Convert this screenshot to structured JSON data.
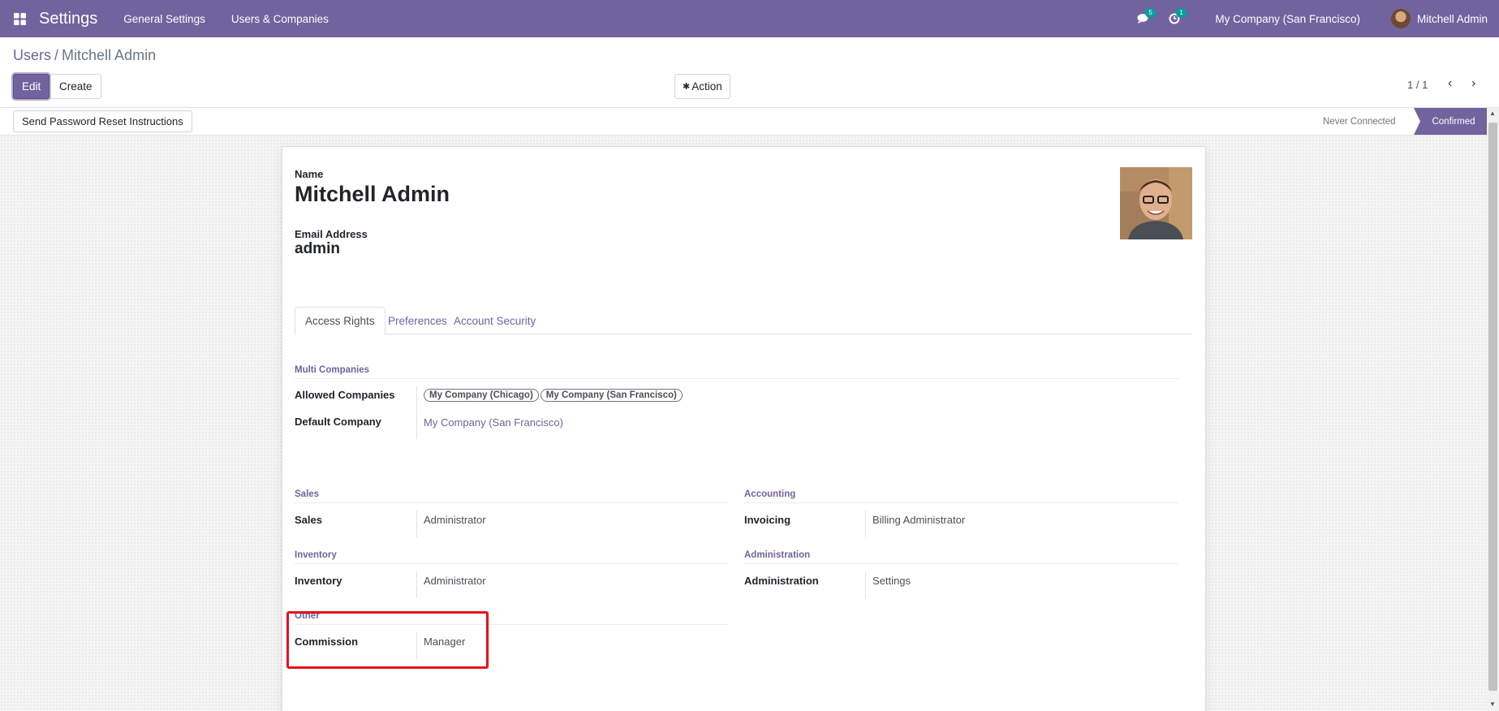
{
  "navbar": {
    "app_title": "Settings",
    "menu": [
      "General Settings",
      "Users & Companies"
    ],
    "messages_badge": "5",
    "activities_badge": "1",
    "company": "My Company (San Francisco)",
    "user_name": "Mitchell Admin",
    "icons": {
      "apps": "apps-grid-icon",
      "messages": "chat-icon",
      "activities": "clock-icon"
    }
  },
  "breadcrumb": {
    "parent": "Users",
    "separator": "/",
    "current": "Mitchell Admin"
  },
  "toolbar": {
    "edit_label": "Edit",
    "create_label": "Create",
    "action_label": "Action",
    "pager": "1 / 1"
  },
  "statusbar": {
    "reset_password_label": "Send Password Reset Instructions",
    "stages": [
      "Never Connected",
      "Confirmed"
    ],
    "active_stage": "Confirmed"
  },
  "form": {
    "name_label": "Name",
    "name_value": "Mitchell Admin",
    "email_label": "Email Address",
    "email_value": "admin",
    "tabs": [
      "Access Rights",
      "Preferences",
      "Account Security"
    ],
    "active_tab": "Access Rights",
    "multi_companies": {
      "title": "Multi Companies",
      "allowed_label": "Allowed Companies",
      "allowed_tags": [
        "My Company (Chicago)",
        "My Company (San Francisco)"
      ],
      "default_label": "Default Company",
      "default_value": "My Company (San Francisco)"
    },
    "groups_left": [
      {
        "title": "Sales",
        "label": "Sales",
        "value": "Administrator"
      },
      {
        "title": "Inventory",
        "label": "Inventory",
        "value": "Administrator"
      },
      {
        "title": "Other",
        "label": "Commission",
        "value": "Manager"
      }
    ],
    "groups_right": [
      {
        "title": "Accounting",
        "label": "Invoicing",
        "value": "Billing Administrator"
      },
      {
        "title": "Administration",
        "label": "Administration",
        "value": "Settings"
      }
    ]
  },
  "colors": {
    "brand": "#71639e",
    "highlight": "#e0141e"
  }
}
